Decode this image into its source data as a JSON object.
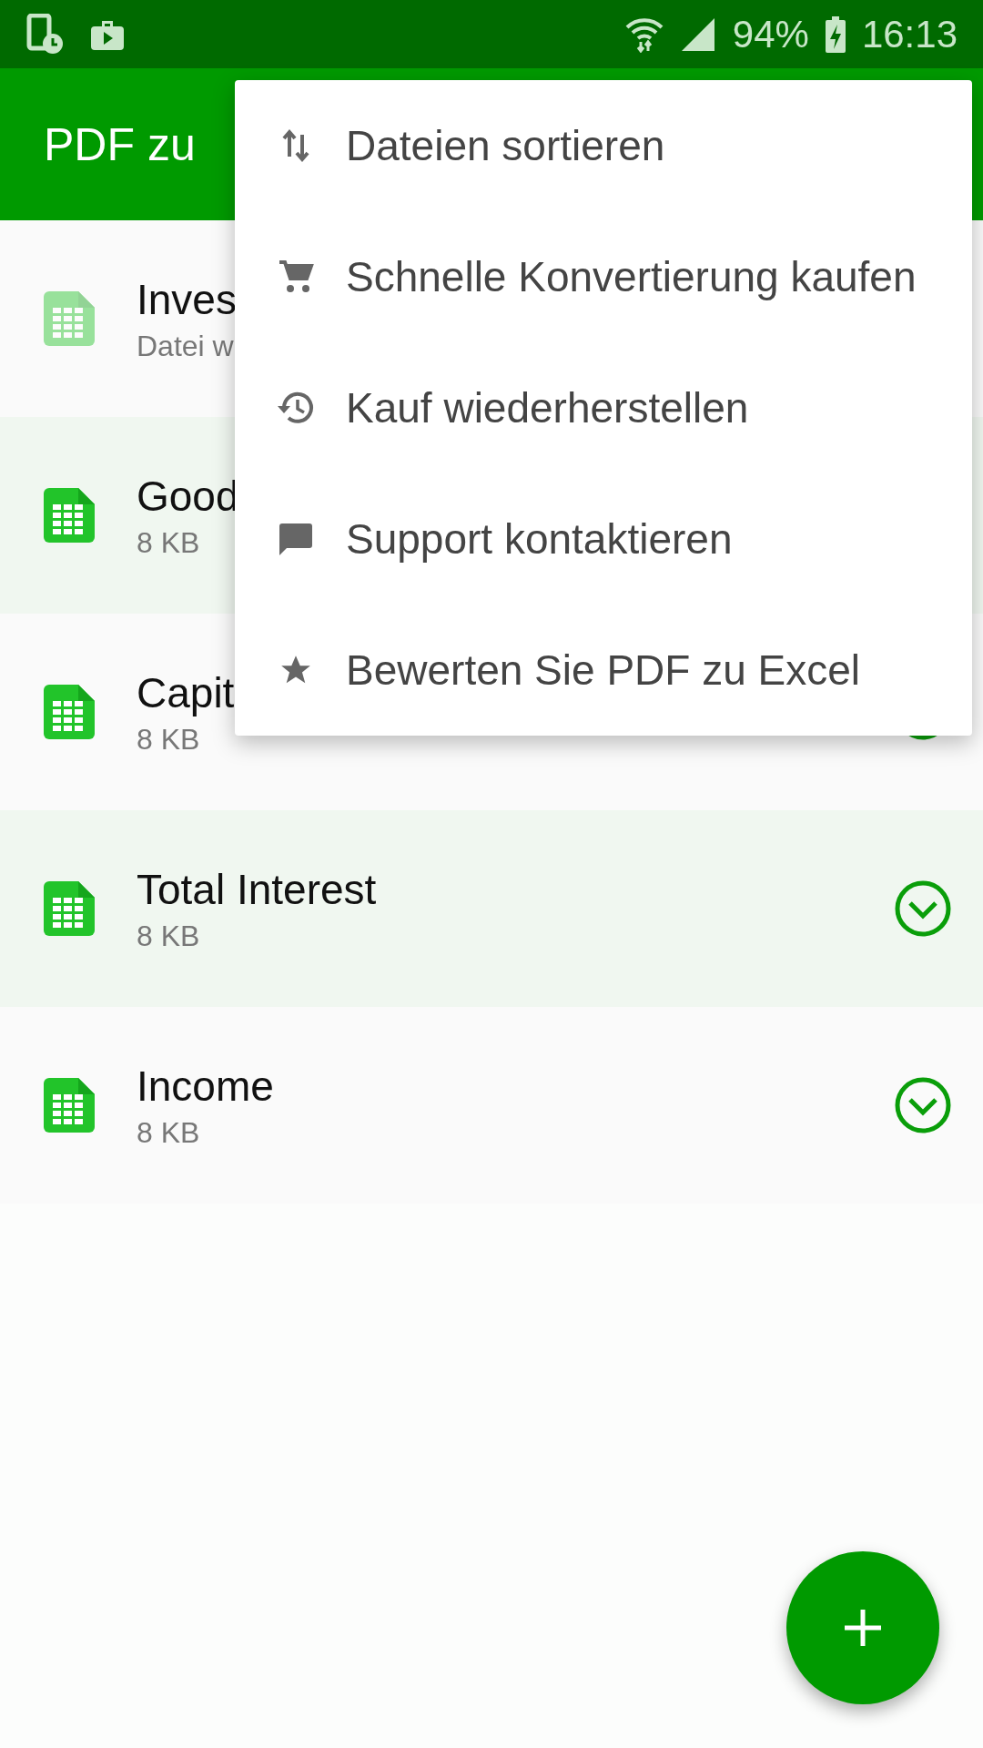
{
  "status_bar": {
    "battery": "94%",
    "time": "16:13"
  },
  "app_bar": {
    "title": "PDF zu"
  },
  "files": [
    {
      "name": "Inves",
      "info": "Datei w",
      "pending": true
    },
    {
      "name": "Good",
      "info": "8 KB",
      "pending": false
    },
    {
      "name": "Capit",
      "info": "8 KB",
      "pending": false,
      "done": true
    },
    {
      "name": "Total Interest",
      "info": "8 KB",
      "pending": false,
      "done": true
    },
    {
      "name": "Income",
      "info": "8 KB",
      "pending": false,
      "done": true
    }
  ],
  "menu": [
    {
      "kind": "sort",
      "label": "Dateien sortieren"
    },
    {
      "kind": "cart",
      "label": "Schnelle Konvertierung kaufen"
    },
    {
      "kind": "history",
      "label": "Kauf wiederherstellen"
    },
    {
      "kind": "chat",
      "label": "Support kontaktieren"
    },
    {
      "kind": "star",
      "label": "Bewerten Sie PDF zu Excel"
    }
  ]
}
